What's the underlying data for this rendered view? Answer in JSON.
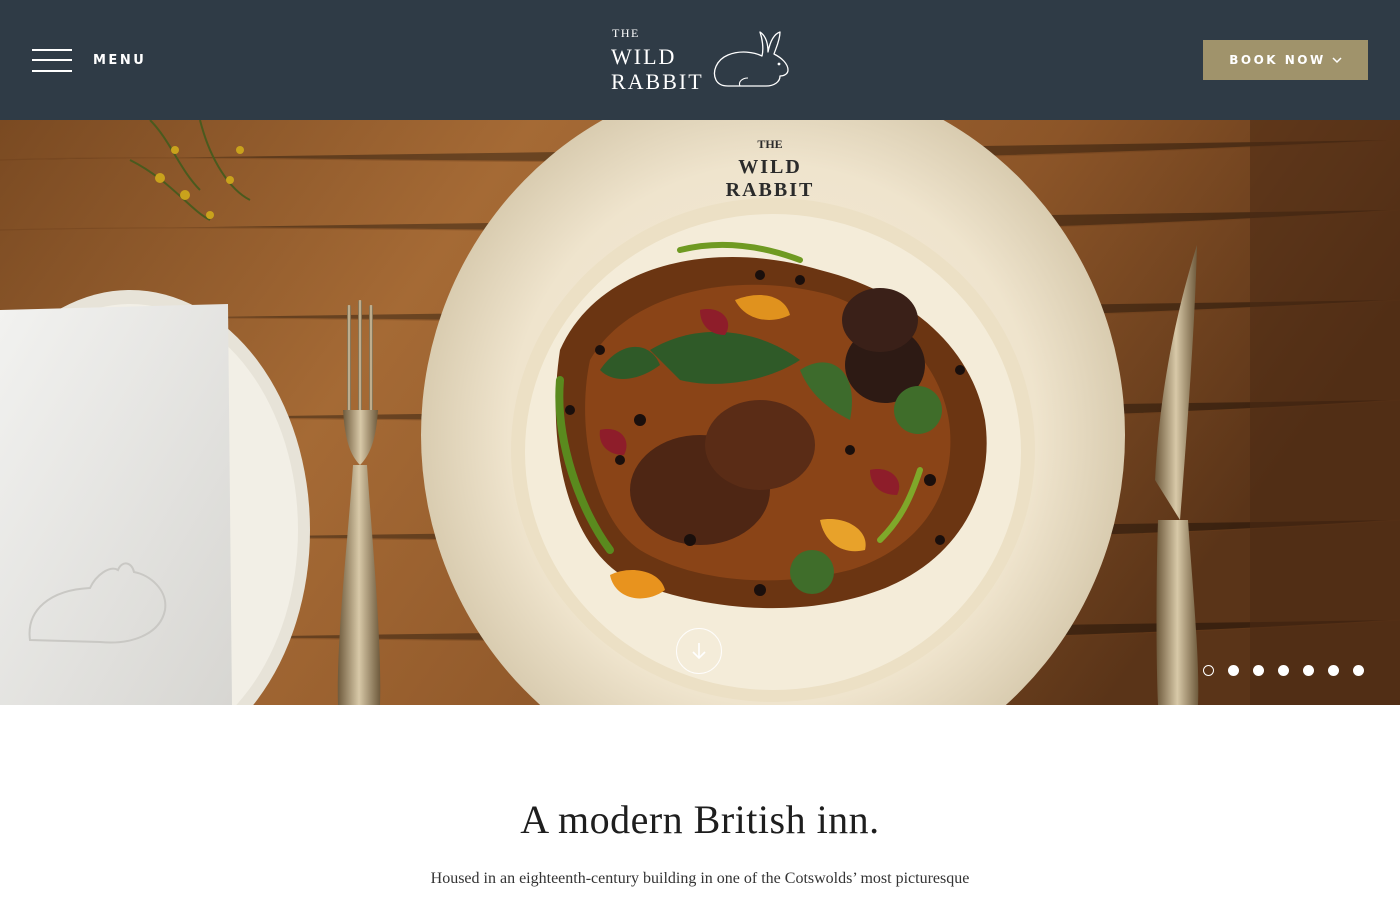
{
  "header": {
    "menu_label": "MENU",
    "logo": {
      "line1": "THE",
      "line2": "WILD",
      "line3": "RABBIT"
    },
    "book_label": "BOOK NOW",
    "book_color": "#a0936b",
    "background": "#2f3b46"
  },
  "hero": {
    "plate_text": {
      "line1": "THE",
      "line2": "WILD",
      "line3": "RABBIT"
    },
    "slides_count": 7,
    "active_slide": 1,
    "scroll_icon": "arrow-down-icon"
  },
  "intro": {
    "title": "A modern British inn.",
    "text": "Housed in an eighteenth-century building in one of the Cotswolds’ most picturesque"
  }
}
